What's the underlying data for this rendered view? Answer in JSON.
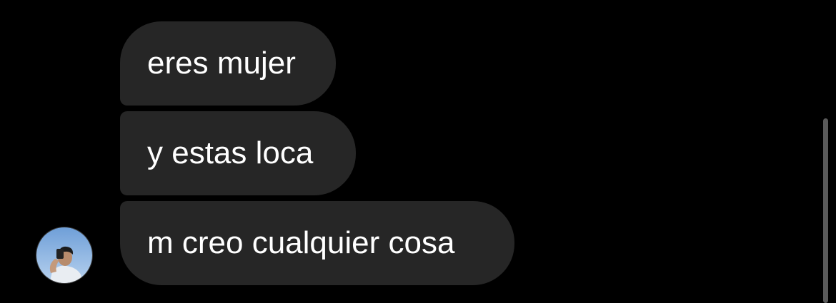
{
  "messages": [
    {
      "text": "eres mujer"
    },
    {
      "text": "y estas loca"
    },
    {
      "text": "m creo cualquier cosa"
    }
  ],
  "sender": {
    "avatar_icon": "profile-photo-icon"
  },
  "colors": {
    "background": "#000000",
    "bubble": "#262626",
    "text": "#ffffff",
    "scrollbar": "#5a5a5a"
  }
}
